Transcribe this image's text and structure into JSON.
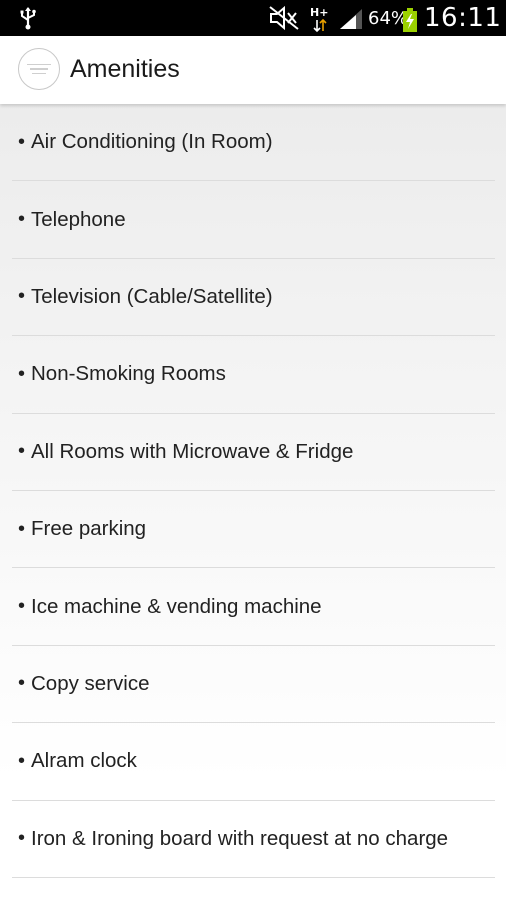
{
  "status_bar": {
    "battery_percent": "64%",
    "time": "16:11",
    "network_type": "H+",
    "icons": [
      "usb-icon",
      "muted-icon",
      "network-activity-icon",
      "signal-icon",
      "battery-charging-icon"
    ]
  },
  "header": {
    "title": "Amenities"
  },
  "amenities": [
    "Air Conditioning (In Room)",
    "Telephone",
    "Television (Cable/Satellite)",
    "Non-Smoking Rooms",
    "All Rooms with Microwave & Fridge",
    "Free parking",
    "Ice machine & vending machine",
    "Copy service",
    "Alram clock",
    "Iron & Ironing board with request at no charge"
  ],
  "bullet": "•",
  "colors": {
    "status_bar_bg": "#000000",
    "header_bg": "#ffffff",
    "text": "#222222",
    "divider": "#dcdcdc"
  }
}
